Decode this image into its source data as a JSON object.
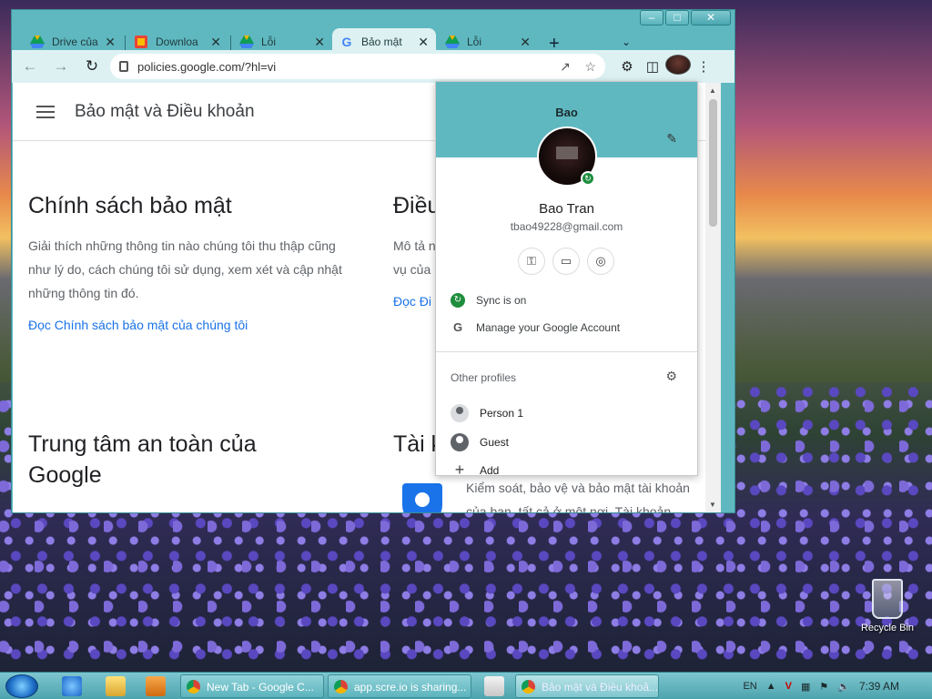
{
  "desktop": {
    "recycle_bin_label": "Recycle Bin"
  },
  "browser": {
    "tabs": [
      {
        "title": "Drive của",
        "icon": "google-drive-icon",
        "active": false
      },
      {
        "title": "Downloa",
        "icon": "downloads-icon",
        "active": false
      },
      {
        "title": "Lỗi",
        "icon": "google-drive-icon",
        "active": false
      },
      {
        "title": "Bảo mật",
        "icon": "google-g-icon",
        "active": true
      },
      {
        "title": "Lỗi",
        "icon": "google-drive-icon",
        "active": false
      }
    ],
    "new_tab_label": "+",
    "url": "policies.google.com/?hl=vi",
    "colors": {
      "frame": "#5fb8c0",
      "toolbar": "#ddf1f3",
      "link": "#1a73e8"
    }
  },
  "page": {
    "header_title": "Bảo mật và Điều khoản",
    "sections": [
      {
        "title": "Chính sách bảo mật",
        "body": "Giải thích những thông tin nào chúng tôi thu thập cũng như lý do, cách chúng tôi sử dụng, xem xét và cập nhật những thông tin đó.",
        "link": "Đọc Chính sách bảo mật của chúng tôi"
      },
      {
        "title": "Điều",
        "body_line1": "Mô tả n",
        "body_line2": "vụ của",
        "link": "Đọc Đi"
      },
      {
        "title": "Trung tâm an toàn của Google"
      },
      {
        "title": "Tài k",
        "body_line1": "Kiểm soát, bảo vệ và bảo mật tài khoản",
        "body_line2": "của bạn, tất cả ở một nơi. Tài khoản"
      }
    ]
  },
  "profile_menu": {
    "header_name": "Bao",
    "full_name": "Bao Tran",
    "email": "tbao49228@gmail.com",
    "sync_label": "Sync is on",
    "manage_label": "Manage your Google Account",
    "other_profiles_label": "Other profiles",
    "profiles": [
      {
        "label": "Person 1"
      },
      {
        "label": "Guest"
      }
    ],
    "add_label": "Add"
  },
  "taskbar": {
    "tasks": [
      {
        "label": "New Tab - Google C..."
      },
      {
        "label": "app.scre.io is sharing..."
      },
      {
        "label": "Bảo mật và Điều khoả..."
      }
    ],
    "language": "EN",
    "clock": "7:39 AM"
  }
}
